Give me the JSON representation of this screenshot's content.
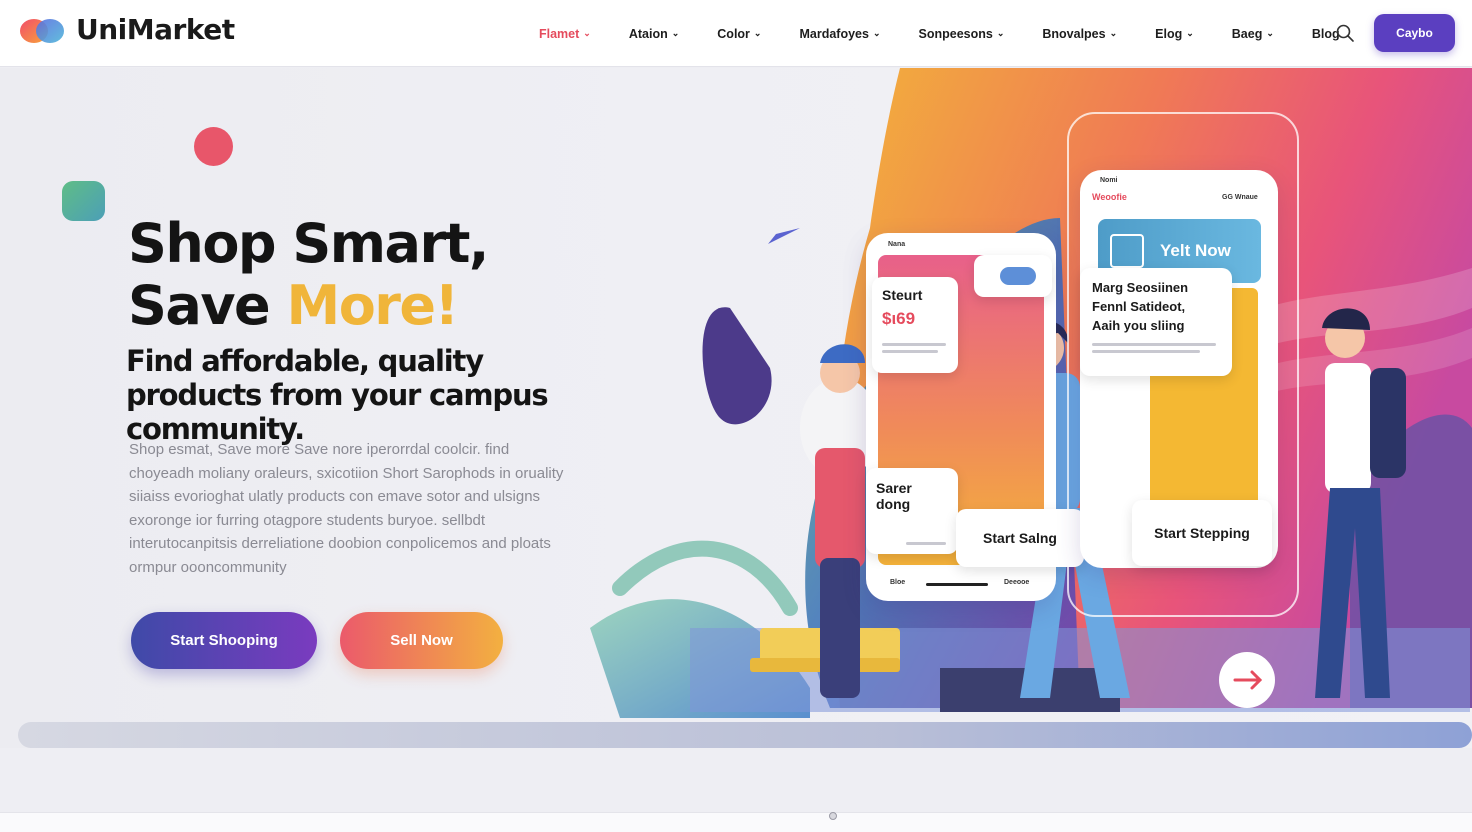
{
  "brand": {
    "name": "UniMarket"
  },
  "nav": {
    "items": [
      {
        "label": "Flamet",
        "dropdown": true,
        "active": true
      },
      {
        "label": "Ataion",
        "dropdown": true
      },
      {
        "label": "Color",
        "dropdown": true
      },
      {
        "label": "Mardafoyes",
        "dropdown": true
      },
      {
        "label": "Sonpeesons",
        "dropdown": true
      },
      {
        "label": "Bnovalpes",
        "dropdown": true
      },
      {
        "label": "Elog",
        "dropdown": true
      },
      {
        "label": "Baeg",
        "dropdown": true
      },
      {
        "label": "Blog",
        "dropdown": false
      }
    ],
    "search_icon": "search-icon",
    "cta_label": "Caybo"
  },
  "hero": {
    "headline_line1": "Shop Smart,",
    "headline_line2_prefix": "Save ",
    "headline_line2_accent": "More!",
    "subhead": "Find affordable, quality products from your campus community.",
    "description": "Shop esmat, Save more Save nore iperorrdal coolcir. find choyeadh moliany oraleurs, sxicotiion Short Sarophods in oruality siiaiss evorioghat ulatly products con emave sotor and ulsigns exoronge ior furring otagpore students buryoe. sellbdt interutocanpitsis derreliatione doobion conpolicemos and ploats ormpur oooncommunity",
    "primary_button": "Start Shooping",
    "secondary_button": "Sell Now"
  },
  "illustration": {
    "phone_left": {
      "status_left": "Nana",
      "card1_title": "Steurt",
      "card1_price": "$ι69",
      "card2_title": "Sarer dong",
      "card3_title": "Start Salng",
      "bottom_left": "Bloe",
      "bottom_right": "Deeooe"
    },
    "phone_right": {
      "status_left": "Nomi",
      "header_left": "Weoofie",
      "header_right": "GG Wnaue",
      "banner_label": "Yelt Now",
      "card_text_1": "Marg Seosiinen",
      "card_text_2": "Fennl Satideot,",
      "card_text_3": "Aaih you sliing",
      "card_button": "Start Stepping"
    }
  },
  "colors": {
    "accent_red": "#e54b5d",
    "accent_yellow": "#f0b53a",
    "cta_purple": "#5b3fc0"
  }
}
